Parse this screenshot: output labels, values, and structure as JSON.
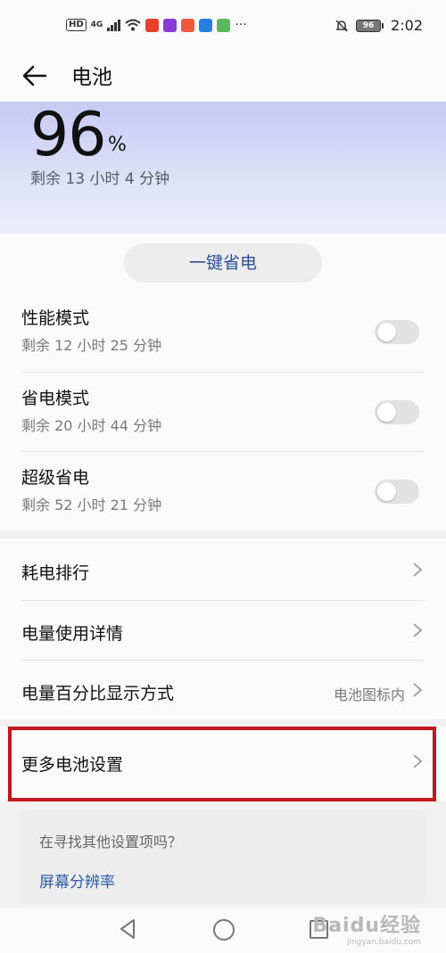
{
  "status_bar": {
    "hd": "HD",
    "signal": "4G",
    "battery": "96",
    "time": "2:02"
  },
  "app_bar": {
    "title": "电池"
  },
  "battery_hero": {
    "percent": "96",
    "unit": "%",
    "remaining": "剩余 13 小时 4 分钟"
  },
  "one_key_save": "一键省电",
  "modes": [
    {
      "name": "性能模式",
      "remaining": "剩余 12 小时 25 分钟",
      "enabled": false
    },
    {
      "name": "省电模式",
      "remaining": "剩余 20 小时 44 分钟",
      "enabled": false
    },
    {
      "name": "超级省电",
      "remaining": "剩余 52 小时 21 分钟",
      "enabled": false
    }
  ],
  "list": [
    {
      "label": "耗电排行",
      "value": ""
    },
    {
      "label": "电量使用详情",
      "value": ""
    },
    {
      "label": "电量百分比显示方式",
      "value": "电池图标内"
    }
  ],
  "more_settings": "更多电池设置",
  "find_card": {
    "question": "在寻找其他设置项吗？",
    "link": "屏幕分辨率"
  },
  "watermark": {
    "main": "Baidu经验",
    "sub": "jingyan.baidu.com"
  },
  "colors": {
    "accent": "#2c4e98",
    "highlight": "#c0181f"
  }
}
